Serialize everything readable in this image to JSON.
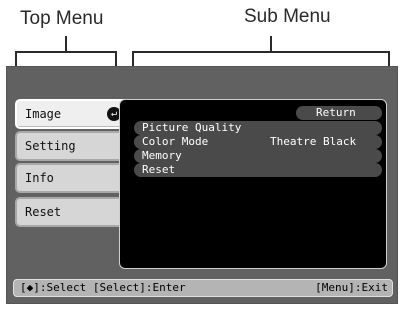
{
  "annotations": {
    "top_menu": "Top Menu",
    "sub_menu": "Sub Menu"
  },
  "top_menu": {
    "items": [
      {
        "label": "Image",
        "active": true
      },
      {
        "label": "Setting"
      },
      {
        "label": "Info"
      },
      {
        "label": "Reset"
      }
    ],
    "active_icon": "enter-arrow-icon"
  },
  "sub_menu": {
    "return_label": "Return",
    "items": [
      {
        "label": "Picture Quality",
        "value": ""
      },
      {
        "label": "Color Mode",
        "value": "Theatre Black"
      },
      {
        "label": "Memory",
        "value": ""
      },
      {
        "label": "Reset",
        "value": ""
      }
    ]
  },
  "status_bar": {
    "select_hint": "[◆]:Select [Select]:Enter",
    "exit_hint": "[Menu]:Exit"
  },
  "colors": {
    "screen_bg": "#616161",
    "panel_bg": "#000000"
  }
}
